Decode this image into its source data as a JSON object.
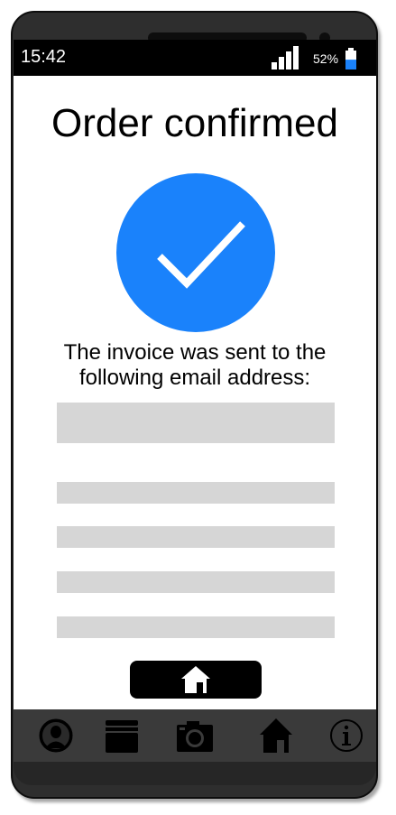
{
  "status_bar": {
    "time": "15:42",
    "battery_percent": "52%",
    "battery_level": 0.52,
    "signal_icon": "signal-bars-icon",
    "battery_icon": "battery-icon"
  },
  "page": {
    "title": "Order confirmed",
    "check_icon": "checkmark-circle-icon",
    "message": "The invoice was sent to the following email address:",
    "email_value": ""
  },
  "home_button": {
    "icon": "home-icon"
  },
  "nav": {
    "items": [
      {
        "icon": "profile-icon"
      },
      {
        "icon": "wallet-icon"
      },
      {
        "icon": "camera-icon"
      },
      {
        "icon": "home-icon"
      },
      {
        "icon": "info-icon"
      }
    ]
  },
  "colors": {
    "accent": "#1a82fb",
    "battery_fill": "#1a82fb",
    "placeholder": "#d6d6d6",
    "nav_bar": "#3a3a3a"
  }
}
